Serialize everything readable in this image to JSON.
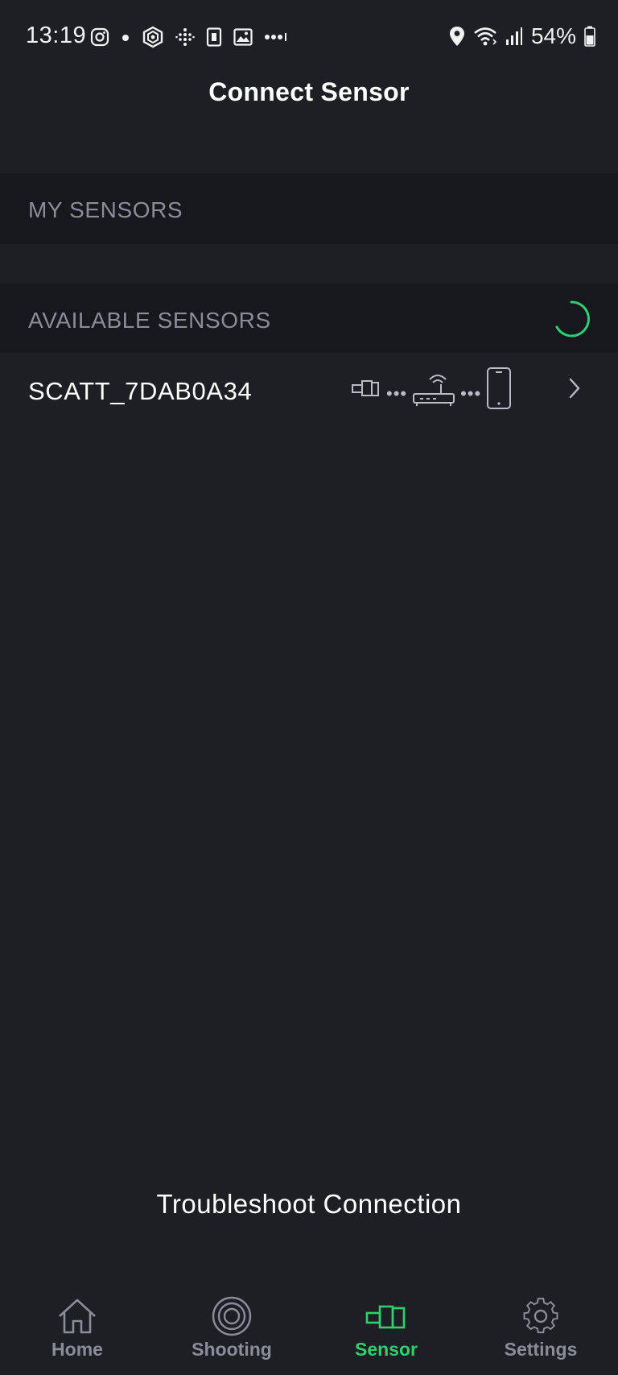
{
  "status_bar": {
    "time": "13:19",
    "battery": "54%",
    "left_icons": [
      "instagram-icon",
      "dot-icon",
      "hex-app-icon",
      "grid-dots-icon",
      "sim-icon",
      "image-icon",
      "more-dots-icon"
    ],
    "right_icons": [
      "location-icon",
      "wifi-icon",
      "signal-icon",
      "battery-icon"
    ]
  },
  "header": {
    "title": "Connect Sensor"
  },
  "sections": {
    "my_sensors": "MY SENSORS",
    "available_sensors": "AVAILABLE SENSORS"
  },
  "available_sensors": [
    {
      "name": "SCATT_7DAB0A34",
      "path_icons": [
        "sensor-icon",
        "router-icon",
        "phone-icon"
      ]
    }
  ],
  "troubleshoot_label": "Troubleshoot Connection",
  "nav": {
    "items": [
      {
        "label": "Home",
        "icon": "home-icon"
      },
      {
        "label": "Shooting",
        "icon": "target-icon"
      },
      {
        "label": "Sensor",
        "icon": "sensor-icon"
      },
      {
        "label": "Settings",
        "icon": "gear-icon"
      }
    ],
    "active": "Sensor"
  },
  "colors": {
    "background": "#1d1f25",
    "section_background": "#17181d",
    "section_text": "#8a8d99",
    "accent": "#2fcf6e"
  }
}
